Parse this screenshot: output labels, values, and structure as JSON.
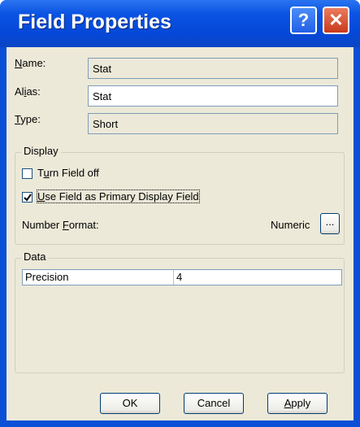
{
  "window": {
    "title": "Field Properties",
    "help_glyph": "?",
    "close_glyph": "✕"
  },
  "fields": {
    "name": {
      "label_pre": "",
      "label_key": "N",
      "label_post": "ame:",
      "value": "Stat"
    },
    "alias": {
      "label_pre": "Al",
      "label_key": "i",
      "label_post": "as:",
      "value": "Stat"
    },
    "type": {
      "label_pre": "",
      "label_key": "T",
      "label_post": "ype:",
      "value": "Short"
    }
  },
  "display": {
    "legend": "Display",
    "turn_off": {
      "pre": "T",
      "key": "u",
      "post": "rn Field off",
      "checked": false
    },
    "primary": {
      "pre": "",
      "key": "U",
      "post": "se Field as Primary Display Field",
      "checked": true
    },
    "number_format": {
      "pre": "Number ",
      "key": "F",
      "post": "ormat:",
      "value": "Numeric",
      "browse": "..."
    }
  },
  "data": {
    "legend": "Data",
    "rows": [
      {
        "property": "Precision",
        "value": "4"
      }
    ]
  },
  "buttons": {
    "ok": "OK",
    "cancel": "Cancel",
    "apply": {
      "key": "A",
      "post": "pply"
    }
  }
}
